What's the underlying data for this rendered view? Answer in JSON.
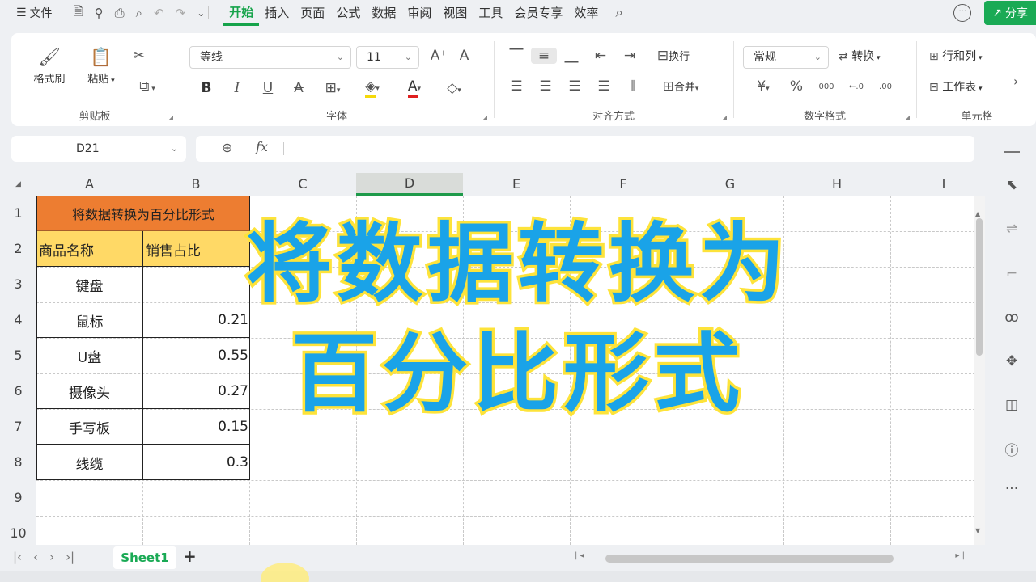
{
  "menubar": {
    "file_label": "文件",
    "tabs": [
      "开始",
      "插入",
      "页面",
      "公式",
      "数据",
      "审阅",
      "视图",
      "工具",
      "会员专享",
      "效率"
    ],
    "active_tab": "开始",
    "share_label": "分享"
  },
  "ribbon": {
    "clipboard": {
      "format_painter": "格式刷",
      "paste": "粘贴",
      "group_label": "剪贴板"
    },
    "font": {
      "font_name": "等线",
      "font_size": "11",
      "group_label": "字体"
    },
    "alignment": {
      "wrap": "换行",
      "merge": "合并",
      "group_label": "对齐方式"
    },
    "number": {
      "format": "常规",
      "convert": "转换",
      "group_label": "数字格式"
    },
    "cells": {
      "row_col": "行和列",
      "worksheet": "工作表",
      "group_label": "单元格"
    }
  },
  "formula_bar": {
    "name_box": "D21",
    "fx": "fx",
    "content": ""
  },
  "columns": [
    "A",
    "B",
    "C",
    "D",
    "E",
    "F",
    "G",
    "H",
    "I"
  ],
  "selected_column": "D",
  "rows": [
    "1",
    "2",
    "3",
    "4",
    "5",
    "6",
    "7",
    "8",
    "9",
    "10"
  ],
  "sheet": {
    "title": "将数据转换为百分比形式",
    "header": [
      "商品名称",
      "销售占比"
    ],
    "items": [
      {
        "name": "键盘",
        "value": ""
      },
      {
        "name": "鼠标",
        "value": "0.21"
      },
      {
        "name": "U盘",
        "value": "0.55"
      },
      {
        "name": "摄像头",
        "value": "0.27"
      },
      {
        "name": "手写板",
        "value": "0.15"
      },
      {
        "name": "线缆",
        "value": "0.3"
      }
    ]
  },
  "overlay": {
    "line1": "将数据转换为",
    "line2": "百分比形式"
  },
  "sheet_tabs": {
    "active": "Sheet1",
    "add": "+"
  },
  "colors": {
    "accent": "#1aaa55",
    "title_fill": "#ed7d31",
    "header_fill": "#ffd966",
    "overlay_text": "#1aa3e8",
    "overlay_stroke": "#fde33a"
  }
}
